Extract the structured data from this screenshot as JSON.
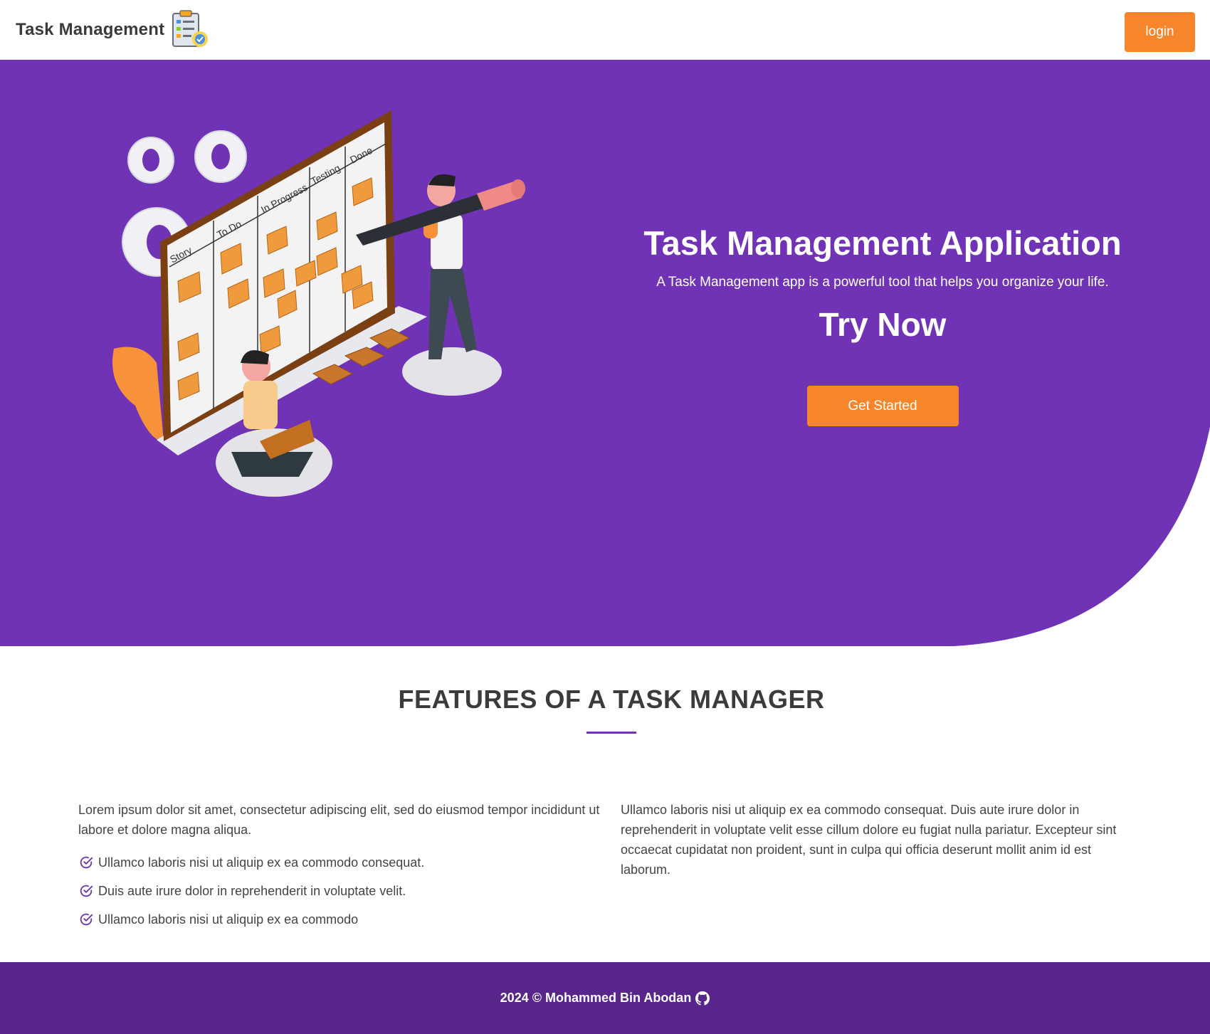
{
  "header": {
    "brand": "Task Management",
    "login_label": "login"
  },
  "hero": {
    "title": "Task Management Application",
    "subtitle": "A Task Management app is a powerful tool that helps you organize your life.",
    "try_now": "Try Now",
    "cta_label": "Get Started",
    "board_columns": [
      "Story",
      "To Do",
      "In Progress",
      "Testing",
      "Done"
    ]
  },
  "features": {
    "title": "FEATURES OF A TASK MANAGER",
    "left_paragraph": "Lorem ipsum dolor sit amet, consectetur adipiscing elit, sed do eiusmod tempor incididunt ut labore et dolore magna aliqua.",
    "list": [
      "Ullamco laboris nisi ut aliquip ex ea commodo consequat.",
      "Duis aute irure dolor in reprehenderit in voluptate velit.",
      "Ullamco laboris nisi ut aliquip ex ea commodo"
    ],
    "right_paragraph": "Ullamco laboris nisi ut aliquip ex ea commodo consequat. Duis aute irure dolor in reprehenderit in voluptate velit esse cillum dolore eu fugiat nulla pariatur. Excepteur sint occaecat cupidatat non proident, sunt in culpa qui officia deserunt mollit anim id est laborum."
  },
  "footer": {
    "text": "2024 © Mohammed Bin Abodan"
  },
  "colors": {
    "primary": "#7133b6",
    "footer": "#58268a",
    "accent": "#f7852a"
  },
  "icons": [
    "clipboard-gear-icon",
    "check-circle-icon",
    "github-icon"
  ]
}
